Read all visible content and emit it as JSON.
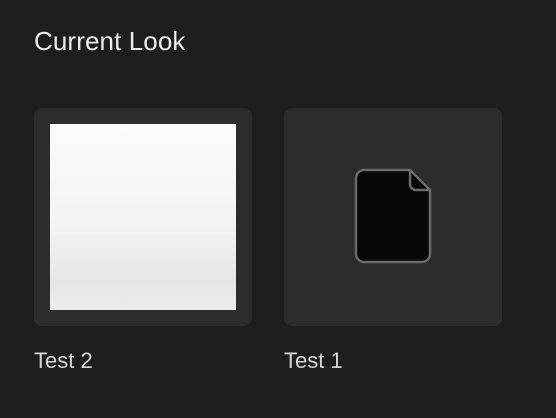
{
  "section": {
    "title": "Current Look"
  },
  "looks": [
    {
      "label": "Test 2",
      "thumbnail": "white-swatch"
    },
    {
      "label": "Test 1",
      "thumbnail": "file-icon"
    }
  ],
  "colors": {
    "background": "#1e1e1e",
    "tile": "#2c2c2c",
    "text": "#d6d6d6",
    "title": "#ececec"
  }
}
